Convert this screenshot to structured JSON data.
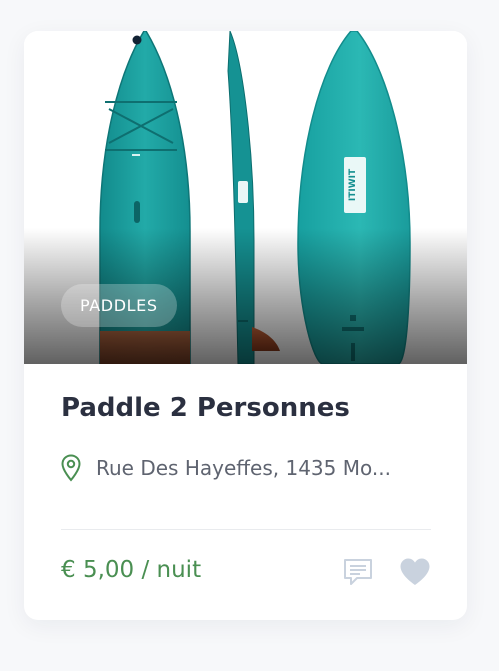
{
  "listing": {
    "category": "PADDLES",
    "title": "Paddle 2 Personnes",
    "address": "Rue Des Hayeffes, 1435 Mo...",
    "price": "€ 5,00 / nuit",
    "brand_mark": "ITIWIT"
  },
  "icons": {
    "location": "location-pin-icon",
    "comment": "comment-icon",
    "favorite": "heart-icon"
  },
  "colors": {
    "price": "#4a8f52",
    "location_pin": "#4a8f52",
    "title": "#2b3040",
    "action_icons": "#c9d2de",
    "board": "#1fa7a6",
    "fin": "#b5532a"
  }
}
